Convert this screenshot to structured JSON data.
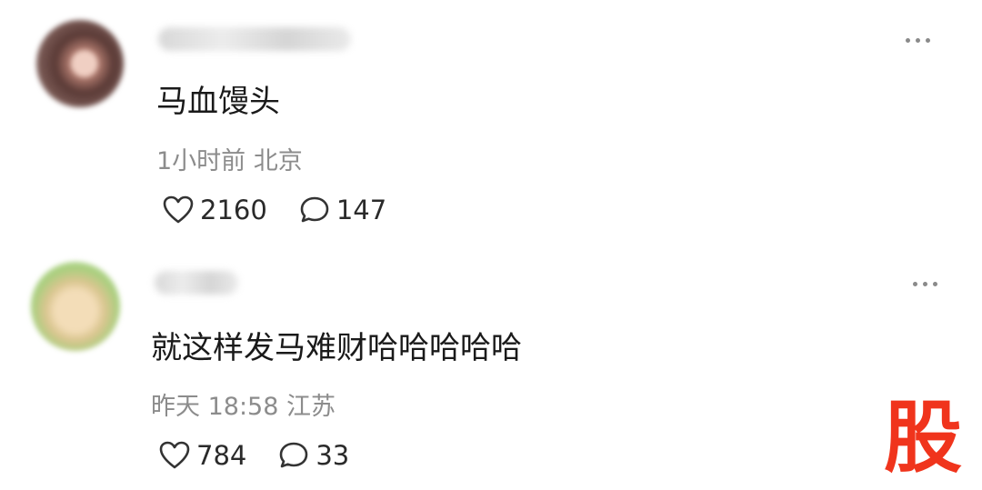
{
  "comments": [
    {
      "text": "马血馒头",
      "meta": "1小时前 北京",
      "likes": "2160",
      "replies": "147"
    },
    {
      "text": "就这样发马难财哈哈哈哈哈",
      "meta": "昨天 18:58 江苏",
      "likes": "784",
      "replies": "33"
    }
  ],
  "watermark": "股",
  "colors": {
    "watermark": "#f0341c",
    "meta": "#8c8c8c"
  },
  "icons": {
    "like": "heart-icon",
    "reply": "comment-bubble-icon",
    "more": "more-dots-icon"
  }
}
